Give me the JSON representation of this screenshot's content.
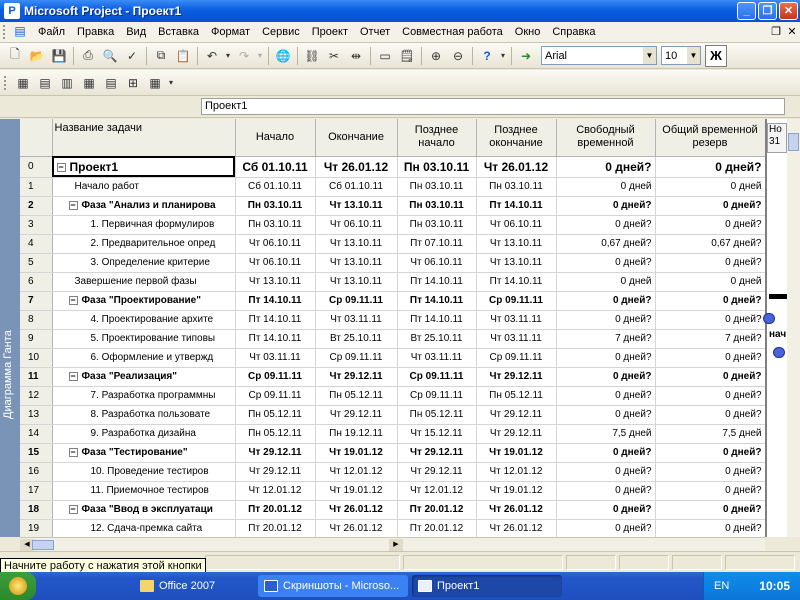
{
  "window": {
    "title": "Microsoft Project - Проект1"
  },
  "menu": [
    "Файл",
    "Правка",
    "Вид",
    "Вставка",
    "Формат",
    "Сервис",
    "Проект",
    "Отчет",
    "Совместная работа",
    "Окно",
    "Справка"
  ],
  "formatting": {
    "font": "Arial",
    "size": "10",
    "bold_label": "Ж"
  },
  "entry_bar": {
    "value": "Проект1"
  },
  "view_bar": {
    "label": "Диаграмма Ганта"
  },
  "table": {
    "headers": [
      "Название задачи",
      "Начало",
      "Окончание",
      "Позднее начало",
      "Позднее окончание",
      "Свободный временной",
      "Общий временной резерв"
    ],
    "rows": [
      {
        "id": "0",
        "name": "Проект1",
        "start": "Сб 01.10.11",
        "finish": "Чт 26.01.12",
        "late_start": "Пн 03.10.11",
        "late_finish": "Чт 26.01.12",
        "free": "0 дней?",
        "total": "0 дней?"
      },
      {
        "id": "1",
        "name": "Начало работ",
        "start": "Сб 01.10.11",
        "finish": "Сб 01.10.11",
        "late_start": "Пн 03.10.11",
        "late_finish": "Пн 03.10.11",
        "free": "0 дней",
        "total": "0 дней"
      },
      {
        "id": "2",
        "name": "Фаза \"Анализ и планирова",
        "start": "Пн 03.10.11",
        "finish": "Чт 13.10.11",
        "late_start": "Пн 03.10.11",
        "late_finish": "Пт 14.10.11",
        "free": "0 дней?",
        "total": "0 дней?"
      },
      {
        "id": "3",
        "name": "1. Первичная формулиров",
        "start": "Пн 03.10.11",
        "finish": "Чт 06.10.11",
        "late_start": "Пн 03.10.11",
        "late_finish": "Чт 06.10.11",
        "free": "0 дней?",
        "total": "0 дней?"
      },
      {
        "id": "4",
        "name": "2. Предварительное опред",
        "start": "Чт 06.10.11",
        "finish": "Чт 13.10.11",
        "late_start": "Пт 07.10.11",
        "late_finish": "Чт 13.10.11",
        "free": "0,67 дней?",
        "total": "0,67 дней?"
      },
      {
        "id": "5",
        "name": "3. Определение критерие",
        "start": "Чт 06.10.11",
        "finish": "Чт 13.10.11",
        "late_start": "Чт 06.10.11",
        "late_finish": "Чт 13.10.11",
        "free": "0 дней?",
        "total": "0 дней?"
      },
      {
        "id": "6",
        "name": "Завершение первой фазы",
        "start": "Чт 13.10.11",
        "finish": "Чт 13.10.11",
        "late_start": "Пт 14.10.11",
        "late_finish": "Пт 14.10.11",
        "free": "0 дней",
        "total": "0 дней"
      },
      {
        "id": "7",
        "name": "Фаза \"Проектирование\"",
        "start": "Пт 14.10.11",
        "finish": "Ср 09.11.11",
        "late_start": "Пт 14.10.11",
        "late_finish": "Ср 09.11.11",
        "free": "0 дней?",
        "total": "0 дней?"
      },
      {
        "id": "8",
        "name": "4. Проектирование архите",
        "start": "Пт 14.10.11",
        "finish": "Чт 03.11.11",
        "late_start": "Пт 14.10.11",
        "late_finish": "Чт 03.11.11",
        "free": "0 дней?",
        "total": "0 дней?"
      },
      {
        "id": "9",
        "name": "5. Проектирование типовы",
        "start": "Пт 14.10.11",
        "finish": "Вт 25.10.11",
        "late_start": "Вт 25.10.11",
        "late_finish": "Чт 03.11.11",
        "free": "7 дней?",
        "total": "7 дней?"
      },
      {
        "id": "10",
        "name": "6. Оформление и утвержд",
        "start": "Чт 03.11.11",
        "finish": "Ср 09.11.11",
        "late_start": "Чт 03.11.11",
        "late_finish": "Ср 09.11.11",
        "free": "0 дней?",
        "total": "0 дней?"
      },
      {
        "id": "11",
        "name": "Фаза \"Реализация\"",
        "start": "Ср 09.11.11",
        "finish": "Чт 29.12.11",
        "late_start": "Ср 09.11.11",
        "late_finish": "Чт 29.12.11",
        "free": "0 дней?",
        "total": "0 дней?"
      },
      {
        "id": "12",
        "name": "7. Разработка программны",
        "start": "Ср 09.11.11",
        "finish": "Пн 05.12.11",
        "late_start": "Ср 09.11.11",
        "late_finish": "Пн 05.12.11",
        "free": "0 дней?",
        "total": "0 дней?"
      },
      {
        "id": "13",
        "name": "8. Разработка пользовате",
        "start": "Пн 05.12.11",
        "finish": "Чт 29.12.11",
        "late_start": "Пн 05.12.11",
        "late_finish": "Чт 29.12.11",
        "free": "0 дней?",
        "total": "0 дней?"
      },
      {
        "id": "14",
        "name": "9. Разработка дизайна",
        "start": "Пн 05.12.11",
        "finish": "Пн 19.12.11",
        "late_start": "Чт 15.12.11",
        "late_finish": "Чт 29.12.11",
        "free": "7,5 дней",
        "total": "7,5 дней"
      },
      {
        "id": "15",
        "name": "Фаза \"Тестирование\"",
        "start": "Чт 29.12.11",
        "finish": "Чт 19.01.12",
        "late_start": "Чт 29.12.11",
        "late_finish": "Чт 19.01.12",
        "free": "0 дней?",
        "total": "0 дней?"
      },
      {
        "id": "16",
        "name": "10. Проведение тестиров",
        "start": "Чт 29.12.11",
        "finish": "Чт 12.01.12",
        "late_start": "Чт 29.12.11",
        "late_finish": "Чт 12.01.12",
        "free": "0 дней?",
        "total": "0 дней?"
      },
      {
        "id": "17",
        "name": "11. Приемочное тестиров",
        "start": "Чт 12.01.12",
        "finish": "Чт 19.01.12",
        "late_start": "Чт 12.01.12",
        "late_finish": "Чт 19.01.12",
        "free": "0 дней?",
        "total": "0 дней?"
      },
      {
        "id": "18",
        "name": "Фаза \"Ввод в эксплуатаци",
        "start": "Пт 20.01.12",
        "finish": "Чт 26.01.12",
        "late_start": "Пт 20.01.12",
        "late_finish": "Чт 26.01.12",
        "free": "0 дней?",
        "total": "0 дней?"
      },
      {
        "id": "19",
        "name": "12. Сдача-премка сайта",
        "start": "Пт 20.01.12",
        "finish": "Чт 26.01.12",
        "late_start": "Пт 20.01.12",
        "late_finish": "Чт 26.01.12",
        "free": "0 дней?",
        "total": "0 дней?"
      }
    ]
  },
  "gantt": {
    "header_top": "Но",
    "header_bottom": "31",
    "label": "нач"
  },
  "status": {
    "tooltip": "Начните работу с нажатия этой кнопки"
  },
  "taskbar": {
    "items": [
      {
        "label": "Office 2007",
        "icon": "folder-icon"
      },
      {
        "label": "Скриншоты - Microso...",
        "icon": "word-icon"
      },
      {
        "label": "Проект1",
        "icon": "project-icon"
      }
    ],
    "lang": "EN",
    "clock": "10:05"
  }
}
